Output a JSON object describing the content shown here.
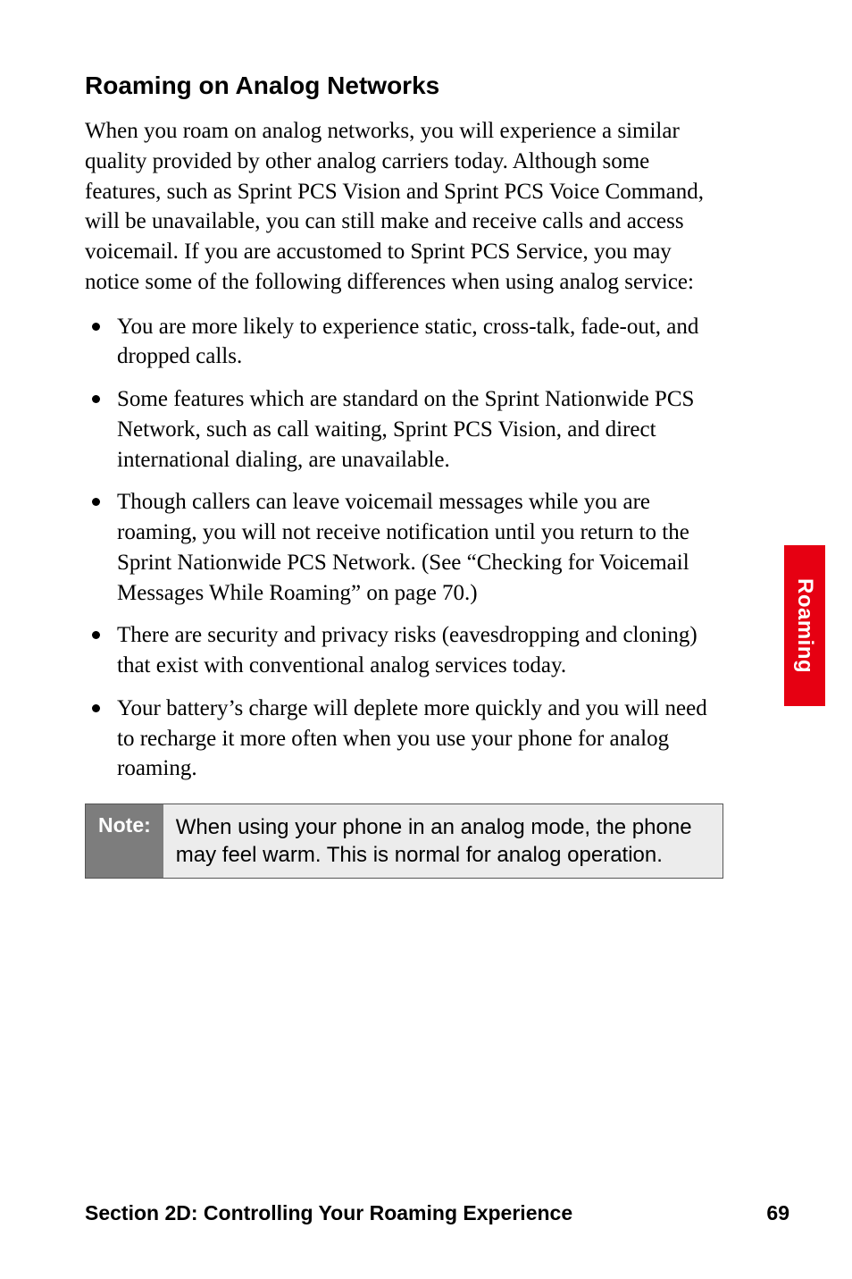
{
  "heading": "Roaming on Analog Networks",
  "intro": "When you roam on analog networks, you will experience a similar quality provided by other analog carriers today. Although some features, such as Sprint PCS Vision and Sprint PCS Voice Command, will be unavailable, you can still make and receive calls and access voicemail. If you are accustomed to Sprint PCS Service, you may notice some of the following differences when using analog service:",
  "bullets": [
    "You are more likely to experience static, cross-talk, fade-out, and dropped calls.",
    "Some features which are standard on the Sprint Nationwide PCS Network, such as call waiting, Sprint PCS Vision, and direct international dialing, are unavailable.",
    "Though callers can leave voicemail messages while you are roaming, you will not receive notification until you return to the Sprint Nationwide PCS Network. (See “Checking for Voicemail Messages While Roaming” on page 70.)",
    "There are security and privacy risks (eavesdropping and cloning) that exist with conventional analog services today.",
    "Your battery’s charge will deplete more quickly and you will need to recharge it more often when you use your phone for analog roaming."
  ],
  "note": {
    "label": "Note:",
    "text": "When using your phone in an analog mode, the phone may feel warm. This is normal for analog operation."
  },
  "sideTab": "Roaming",
  "footer": {
    "section": "Section 2D: Controlling Your Roaming Experience",
    "page": "69"
  }
}
